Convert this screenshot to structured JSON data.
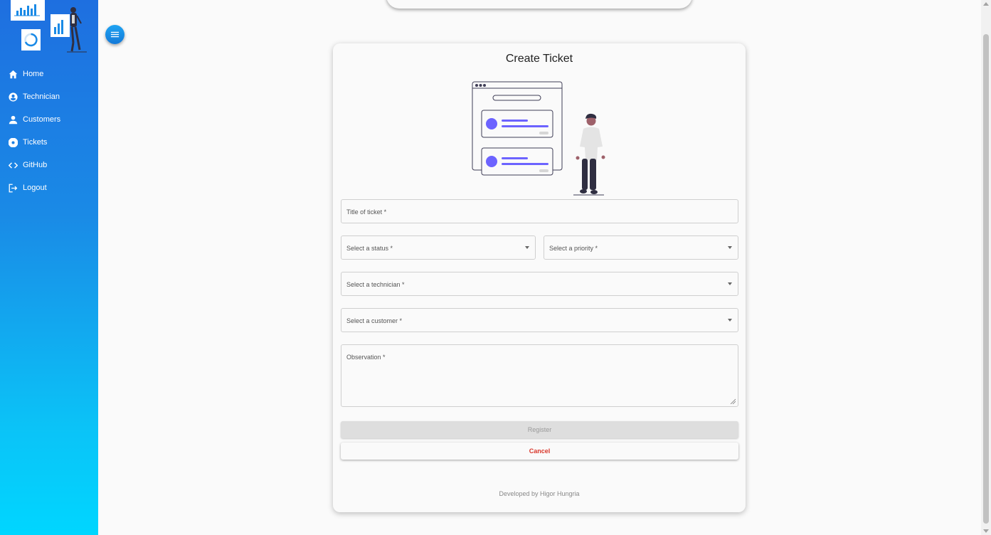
{
  "sidebar": {
    "items": [
      {
        "label": "Home",
        "icon": "home-icon"
      },
      {
        "label": "Technician",
        "icon": "user-circle-icon"
      },
      {
        "label": "Customers",
        "icon": "person-icon"
      },
      {
        "label": "Tickets",
        "icon": "lifebuoy-icon"
      },
      {
        "label": "GitHub",
        "icon": "code-icon"
      },
      {
        "label": "Logout",
        "icon": "logout-icon"
      }
    ]
  },
  "form": {
    "title": "Create Ticket",
    "title_field": "Title of ticket *",
    "status_field": "Select a status *",
    "priority_field": "Select a priority *",
    "technician_field": "Select a technician *",
    "customer_field": "Select a customer *",
    "observation_field": "Observation *",
    "register_label": "Register",
    "cancel_label": "Cancel"
  },
  "footer": "Developed by Higor Hungria",
  "colors": {
    "sidebar_top": "#1e6fe0",
    "sidebar_bottom": "#00d6ff",
    "accent_purple": "#6c63ff",
    "cancel_red": "#d9372b"
  }
}
